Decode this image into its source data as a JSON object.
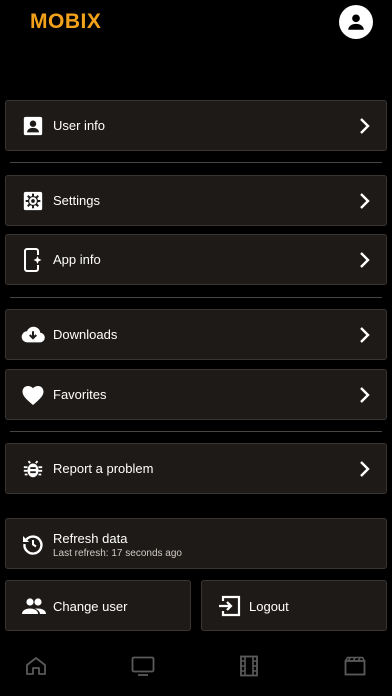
{
  "app": {
    "logo": "MOBIX"
  },
  "header": {
    "avatar_icon": "account-circle-icon"
  },
  "menu": {
    "user_info": "User info",
    "settings": "Settings",
    "app_info": "App info",
    "downloads": "Downloads",
    "favorites": "Favorites",
    "report": "Report a problem",
    "refresh": {
      "title": "Refresh data",
      "subtitle": "Last refresh: 17 seconds ago"
    },
    "change_user": "Change user",
    "logout": "Logout"
  },
  "tabs": [
    {
      "icon": "home-icon"
    },
    {
      "icon": "tv-icon"
    },
    {
      "icon": "film-icon"
    },
    {
      "icon": "clapperboard-icon"
    }
  ],
  "colors": {
    "accent": "#f3a21b",
    "row_bg": "#1e1a17",
    "row_border": "#3a3531",
    "background": "#000000"
  }
}
